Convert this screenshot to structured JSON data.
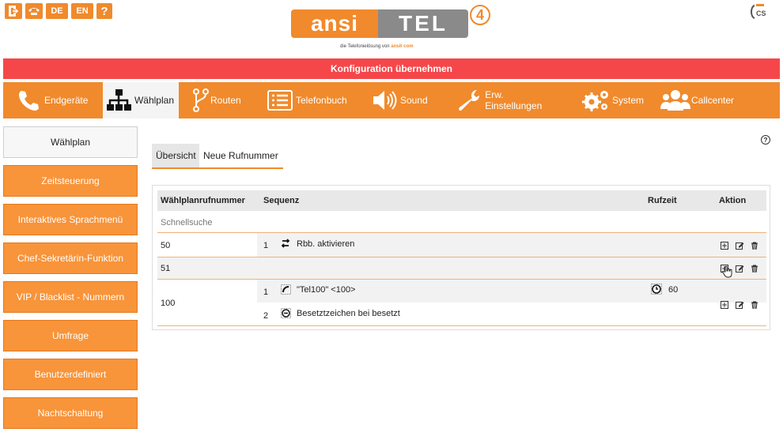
{
  "header": {
    "lang_de": "DE",
    "lang_en": "EN",
    "help": "?",
    "logo_left": "ansi",
    "logo_right": "TEL",
    "logo_number": "4",
    "logo_tagline_prefix": "die Telefonielösung von",
    "logo_tagline_brand": "ansit·com",
    "cs_badge": "CS"
  },
  "apply_bar": {
    "label": "Konfiguration übernehmen"
  },
  "nav": {
    "items": [
      {
        "label": "Endgeräte",
        "icon": "phone-icon"
      },
      {
        "label": "Wählplan",
        "icon": "sitemap-icon",
        "active": true
      },
      {
        "label": "Routen",
        "icon": "fork-icon"
      },
      {
        "label": "Telefonbuch",
        "icon": "list-icon"
      },
      {
        "label": "Sound",
        "icon": "speaker-icon"
      },
      {
        "label": "Erw. Einstellungen",
        "icon": "wrench-icon"
      },
      {
        "label": "System",
        "icon": "gears-icon"
      },
      {
        "label": "Callcenter",
        "icon": "users-icon"
      }
    ]
  },
  "sidebar": {
    "items": [
      {
        "label": "Wählplan",
        "active": true
      },
      {
        "label": "Zeitsteuerung"
      },
      {
        "label": "Interaktives Sprachmenü"
      },
      {
        "label": "Chef-Sekretärin-Funktion"
      },
      {
        "label": "VIP / Blacklist - Nummern"
      },
      {
        "label": "Umfrage"
      },
      {
        "label": "Benutzerdefiniert"
      },
      {
        "label": "Nachtschaltung"
      }
    ]
  },
  "tabs": {
    "overview": "Übersicht",
    "new_number": "Neue Rufnummer"
  },
  "table": {
    "headers": {
      "number": "Wählplanrufnummer",
      "sequence": "Sequenz",
      "ringtime": "Rufzeit",
      "action": "Aktion"
    },
    "quicksearch": "Schnellsuche",
    "rows": [
      {
        "number": "50",
        "steps": [
          {
            "idx": "1",
            "text": "Rbb. aktivieren",
            "icon": "transfer-icon"
          }
        ]
      },
      {
        "number": "51",
        "steps": []
      },
      {
        "number": "100",
        "steps": [
          {
            "idx": "1",
            "text": "\"Tel100\" <100>",
            "icon": "handset-icon",
            "ringtime": "60"
          },
          {
            "idx": "2",
            "text": "Besetztzeichen bei besetzt",
            "icon": "busy-icon"
          }
        ]
      }
    ]
  },
  "colors": {
    "accent": "#f08a2c",
    "alert": "#f5474a",
    "grey": "#8a8a8a"
  }
}
